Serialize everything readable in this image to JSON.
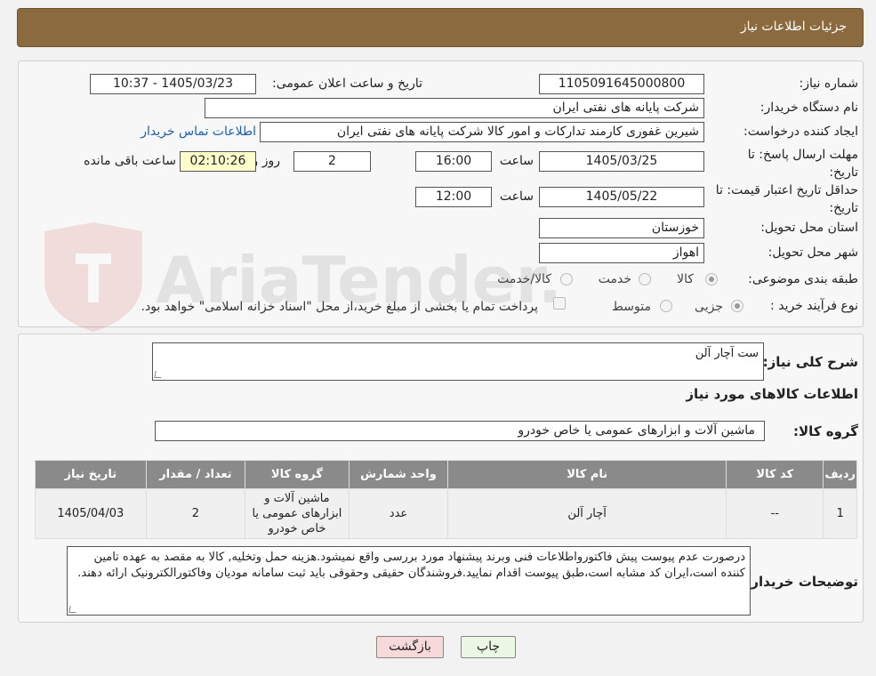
{
  "header": {
    "title": "جزئيات اطلاعات نياز"
  },
  "form": {
    "need_number_label": "شماره نیاز:",
    "need_number": "1105091645000800",
    "announce_label": "تاریخ و ساعت اعلان عمومی:",
    "announce_value": "1405/03/23 - 10:37",
    "buyer_org_label": "نام دستگاه خریدار:",
    "buyer_org": "شرکت پایانه های نفتی ایران",
    "requester_label": "ایجاد کننده درخواست:",
    "requester": "شیرین غفوری کارمند تدارکات و امور کالا شرکت پایانه های نفتی ایران",
    "contact_link": "اطلاعات تماس خریدار",
    "reply_deadline_label": "مهلت ارسال پاسخ: تا تاریخ:",
    "reply_date": "1405/03/25",
    "time_label": "ساعت",
    "reply_time": "16:00",
    "days_value": "2",
    "days_label": "روز و",
    "remaining_time": "02:10:26",
    "remaining_label": "ساعت باقی مانده",
    "price_validity_label": "حداقل تاریخ اعتبار قیمت: تا تاریخ:",
    "price_date": "1405/05/22",
    "price_time": "12:00",
    "province_label": "استان محل تحویل:",
    "province": "خوزستان",
    "city_label": "شهر محل تحویل:",
    "city": "اهواز",
    "category_label": "طبقه بندی موضوعی:",
    "category_options": [
      "کالا",
      "خدمت",
      "کالا/خدمت"
    ],
    "process_label": "نوع فرآیند خرید :",
    "process_options": [
      "جزیی",
      "متوسط"
    ],
    "payment_note": "پرداخت تمام یا بخشی از مبلغ خرید،از محل \"اسناد خزانه اسلامی\" خواهد بود."
  },
  "details": {
    "summary_label": "شرح کلی نیاز:",
    "summary": "ست آچار آلن",
    "goods_info_title": "اطلاعات کالاهای مورد نیاز",
    "group_label": "گروه کالا:",
    "group_value": "ماشین آلات و ابزارهای عمومی یا خاص خودرو",
    "table_headers": [
      "ردیف",
      "کد کالا",
      "نام کالا",
      "واحد شمارش",
      "گروه کالا",
      "تعداد / مقدار",
      "تاریخ نیاز"
    ],
    "rows": [
      [
        "1",
        "--",
        "آچار آلن",
        "عدد",
        "ماشین آلات و ابزارهای عمومی یا خاص خودرو",
        "2",
        "1405/04/03"
      ]
    ],
    "buyer_notes_label": "توضیحات خریدار:",
    "buyer_notes": "درصورت عدم پیوست پیش فاکتورواطلاعات فنی وبرند پیشنهاد مورد بررسی واقع نمیشود.هزینه حمل وتخلیه, کالا به مقصد به عهده تامین کننده است،ایران کد مشابه است،طبق پیوست اقدام نمایید.فروشندگان حقیقی وحقوقی باید ثبت سامانه مودیان وفاکتورالکترونیک ارائه دهند."
  },
  "buttons": {
    "print": "چاپ",
    "back": "بازگشت"
  },
  "watermark": {
    "text": "AriaTender.neT"
  }
}
